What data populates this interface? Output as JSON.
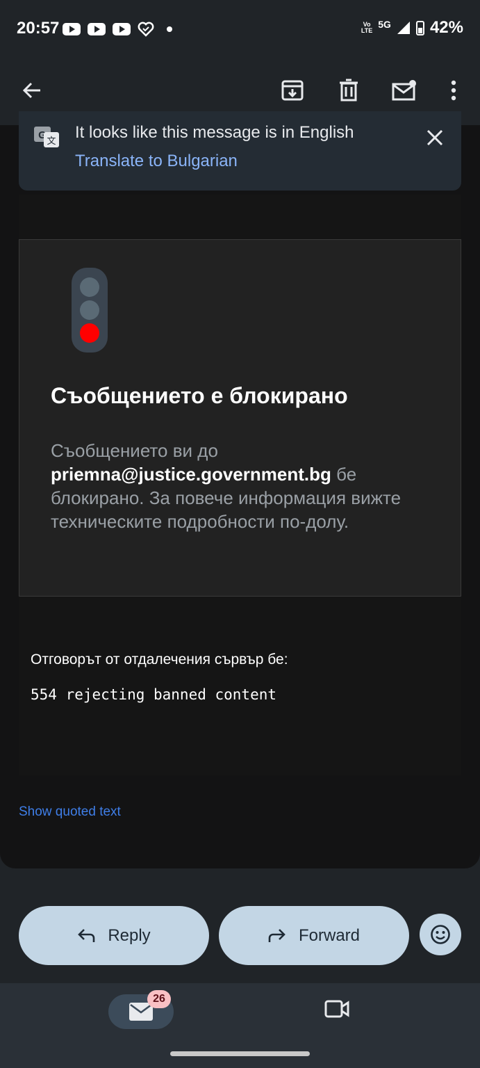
{
  "status_bar": {
    "time": "20:57",
    "network_top": "Vo",
    "network_bottom": "LTE",
    "network_5g": "5G",
    "battery": "42%"
  },
  "translate_banner": {
    "message": "It looks like this message is in English",
    "link": "Translate to Bulgarian"
  },
  "blocked": {
    "title": "Съобщението е блокирано",
    "text_before": "Съобщението ви до",
    "email": "priemna@justice.government.bg",
    "text_after": "бе блокирано. За повече информация вижте техническите подробности по-долу."
  },
  "server": {
    "label": "Отговорът от отдалечения сървър бе:",
    "code": "554 rejecting banned content"
  },
  "show_quoted": "Show quoted text",
  "actions": {
    "reply": "Reply",
    "forward": "Forward"
  },
  "bottom_nav": {
    "mail_badge": "26"
  },
  "colors": {
    "background": "#202428",
    "link": "#8ab4f8",
    "button": "#c3d6e5",
    "stoplight_red": "#ff0000"
  }
}
